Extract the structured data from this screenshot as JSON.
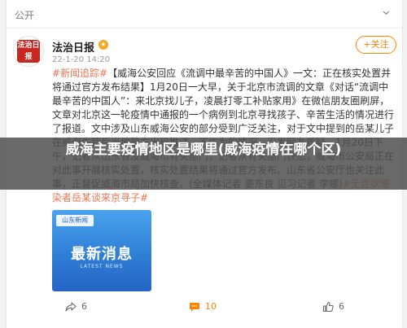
{
  "header": {
    "visibility": "公开",
    "more": "⌄"
  },
  "post": {
    "author": "法治日报",
    "verified": "★",
    "time": "22-1-20 14:20",
    "follow_label": "+关注",
    "avatar_text": "法治日报",
    "segments": [
      {
        "text": "#新闻追踪#",
        "type": "hashtag"
      },
      {
        "text": "【威海公安回应《流调中最辛苦的中国人》一文：正在核实处置并将通过官方发布结果】1月20日一大早，关于北京市流调的文章《对话“流调中最辛苦的中国人”：来北京找儿子，凌晨打零工补贴家用》在微信朋友圈刷屏，文章对北京这一轮疫情中通报的一个病例到北京寻找孩子、辛苦生活的情况进行了报道。文中涉及山东威海公安的部分受到广泛关注，对于文中提到的岳某儿子在威海失踪后当地警方出现推诿、不作为的情况，引发网友质疑。1月20日下午，记者从山东省及威海市有关部门，记者从有关部门获悉，威海市公安局正在对此事开展核实处置，核实处置结果将通过官方发布。山东省公安厅也关注此事，正督促威海市局加快核查。(全媒体记者 姜东良 见习记者 李娜)",
        "type": "text"
      },
      {
        "text": "#无症状感染者岳某谈来京寻子#",
        "type": "hashtag"
      }
    ]
  },
  "banner": {
    "title": "威海主要疫情地区是哪里(威海疫情在哪个区)"
  },
  "image": {
    "badge": "山东新闻",
    "title": "最新消息",
    "subtitle": "LATEST NEWS"
  },
  "actions": {
    "share_count": "6",
    "comment_count": "10",
    "like_count": "6"
  },
  "colors": {
    "accent": "#ff8200",
    "hashtag": "#eb7350"
  }
}
